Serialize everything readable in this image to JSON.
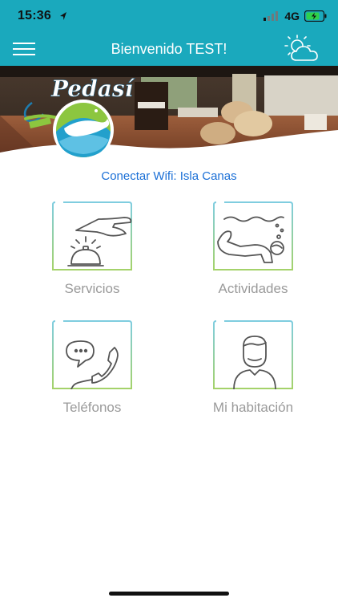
{
  "status": {
    "time": "15:36",
    "network": "4G"
  },
  "header": {
    "title": "Bienvenido TEST!"
  },
  "brand": {
    "logo_text": "Pedasí"
  },
  "wifi": {
    "label": "Conectar Wifi: Isla Canas"
  },
  "tiles": [
    {
      "label": "Servicios",
      "icon": "bell-icon"
    },
    {
      "label": "Actividades",
      "icon": "diver-icon"
    },
    {
      "label": "Teléfonos",
      "icon": "phone-icon"
    },
    {
      "label": "Mi habitación",
      "icon": "person-icon"
    }
  ],
  "colors": {
    "header": "#1aa9bd",
    "link": "#1a6fd6",
    "tile_label": "#9a9a9a",
    "frame_top": "#7fcde0",
    "frame_bottom": "#a4d26a"
  }
}
